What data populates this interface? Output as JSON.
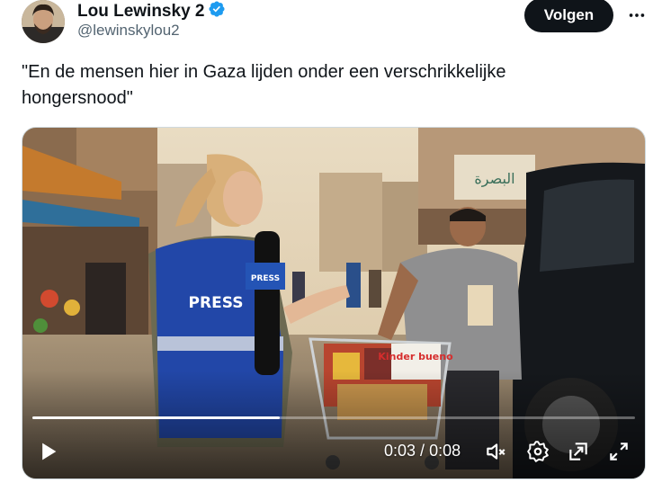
{
  "author": {
    "display_name": "Lou Lewinsky 2",
    "handle": "@lewinskylou2",
    "verified": true
  },
  "follow_button": {
    "label": "Volgen"
  },
  "tweet": {
    "text": "\"En de mensen hier in Gaza lijden onder een verschrikkelijke hongersnood\""
  },
  "video": {
    "current_time": "0:03",
    "separator": " / ",
    "duration": "0:08",
    "progress_fraction": 0.41,
    "scene_text": {
      "vest_press": "PRESS",
      "mic_press": "PRESS",
      "package_label": "Kinder bueno",
      "shop_sign": "البصرة"
    }
  },
  "colors": {
    "follow_bg": "#0f1419",
    "verified": "#1d9bf0",
    "handle": "#536471"
  },
  "icons": {
    "verified": "verified-badge-icon",
    "more": "more-icon",
    "play": "play-icon",
    "mute": "mute-icon",
    "settings": "settings-icon",
    "pip": "pip-icon",
    "fullscreen": "fullscreen-icon"
  }
}
